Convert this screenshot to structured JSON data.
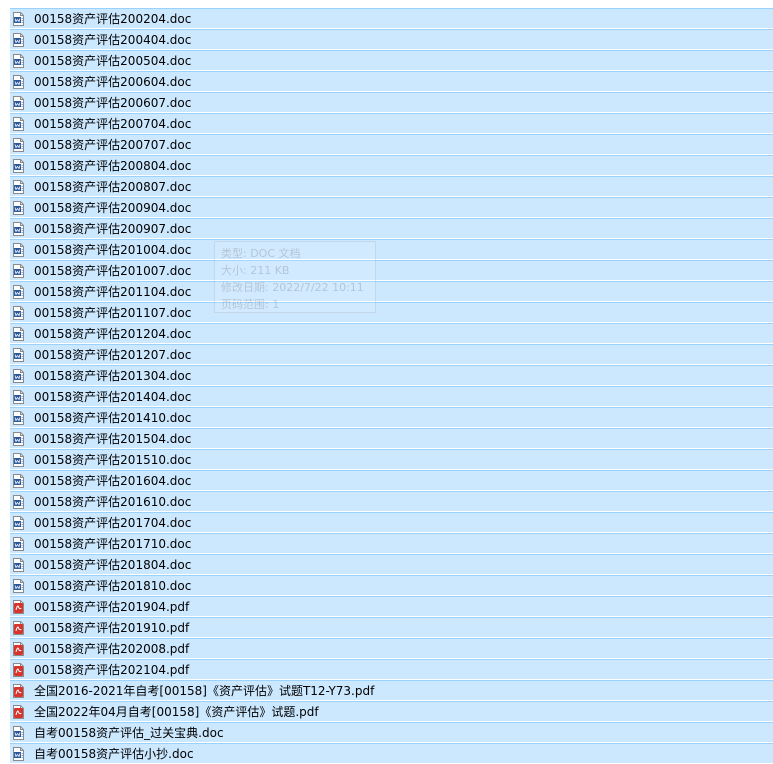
{
  "files": [
    {
      "name": "00158资产评估200204.doc",
      "icon": "doc-file-icon"
    },
    {
      "name": "00158资产评估200404.doc",
      "icon": "doc-file-icon"
    },
    {
      "name": "00158资产评估200504.doc",
      "icon": "doc-file-icon"
    },
    {
      "name": "00158资产评估200604.doc",
      "icon": "doc-file-icon"
    },
    {
      "name": "00158资产评估200607.doc",
      "icon": "doc-file-icon"
    },
    {
      "name": "00158资产评估200704.doc",
      "icon": "doc-file-icon"
    },
    {
      "name": "00158资产评估200707.doc",
      "icon": "doc-file-icon"
    },
    {
      "name": "00158资产评估200804.doc",
      "icon": "doc-file-icon"
    },
    {
      "name": "00158资产评估200807.doc",
      "icon": "doc-file-icon"
    },
    {
      "name": "00158资产评估200904.doc",
      "icon": "doc-file-icon"
    },
    {
      "name": "00158资产评估200907.doc",
      "icon": "doc-file-icon"
    },
    {
      "name": "00158资产评估201004.doc",
      "icon": "doc-file-icon"
    },
    {
      "name": "00158资产评估201007.doc",
      "icon": "doc-file-icon"
    },
    {
      "name": "00158资产评估201104.doc",
      "icon": "doc-file-icon"
    },
    {
      "name": "00158资产评估201107.doc",
      "icon": "doc-file-icon"
    },
    {
      "name": "00158资产评估201204.doc",
      "icon": "doc-file-icon"
    },
    {
      "name": "00158资产评估201207.doc",
      "icon": "doc-file-icon"
    },
    {
      "name": "00158资产评估201304.doc",
      "icon": "doc-file-icon"
    },
    {
      "name": "00158资产评估201404.doc",
      "icon": "doc-file-icon"
    },
    {
      "name": "00158资产评估201410.doc",
      "icon": "doc-file-icon"
    },
    {
      "name": "00158资产评估201504.doc",
      "icon": "doc-file-icon"
    },
    {
      "name": "00158资产评估201510.doc",
      "icon": "doc-file-icon"
    },
    {
      "name": "00158资产评估201604.doc",
      "icon": "doc-file-icon"
    },
    {
      "name": "00158资产评估201610.doc",
      "icon": "doc-file-icon"
    },
    {
      "name": "00158资产评估201704.doc",
      "icon": "doc-file-icon"
    },
    {
      "name": "00158资产评估201710.doc",
      "icon": "doc-file-icon"
    },
    {
      "name": "00158资产评估201804.doc",
      "icon": "doc-file-icon"
    },
    {
      "name": "00158资产评估201810.doc",
      "icon": "doc-file-icon"
    },
    {
      "name": "00158资产评估201904.pdf",
      "icon": "pdf-file-icon"
    },
    {
      "name": "00158资产评估201910.pdf",
      "icon": "pdf-file-icon"
    },
    {
      "name": "00158资产评估202008.pdf",
      "icon": "pdf-file-icon"
    },
    {
      "name": "00158资产评估202104.pdf",
      "icon": "pdf-file-icon"
    },
    {
      "name": "全国2016-2021年自考[00158]《资产评估》试题T12-Y73.pdf",
      "icon": "pdf-file-icon"
    },
    {
      "name": "全国2022年04月自考[00158]《资产评估》试题.pdf",
      "icon": "pdf-file-icon"
    },
    {
      "name": "自考00158资产评估_过关宝典.doc",
      "icon": "doc-file-icon"
    },
    {
      "name": "自考00158资产评估小抄.doc",
      "icon": "doc-file-icon"
    }
  ],
  "tooltip": {
    "type_line": "类型: DOC 文档",
    "size_line": "大小: 211 KB",
    "modified_line": "修改日期: 2022/7/22 10:11",
    "pages_line": "页码范围: 1"
  },
  "colors": {
    "selected_row_bg": "#cce8ff",
    "selected_row_border": "#99d1ff",
    "doc_icon_blue": "#2b579a",
    "pdf_icon_red": "#d9342b"
  }
}
